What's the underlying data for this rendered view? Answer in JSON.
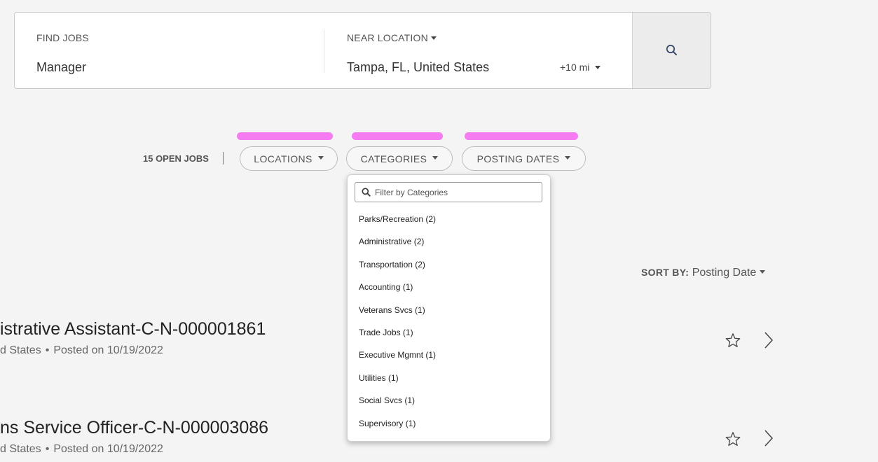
{
  "search": {
    "find_jobs_label": "FIND JOBS",
    "find_jobs_value": "Manager",
    "near_location_label": "NEAR LOCATION",
    "location_value": "Tampa, FL, United States",
    "radius_value": "+10 mi",
    "search_icon": "magnifier-icon"
  },
  "filters": {
    "jobs_count": "15 OPEN JOBS",
    "locations_label": "LOCATIONS",
    "categories_label": "CATEGORIES",
    "posting_dates_label": "POSTING DATES",
    "highlight_color": "#f47cf0"
  },
  "categories_dropdown": {
    "placeholder": "Filter by Categories",
    "options": [
      "Parks/Recreation (2)",
      "Administrative (2)",
      "Transportation (2)",
      "Accounting (1)",
      "Veterans Svcs (1)",
      "Trade Jobs (1)",
      "Executive Mgmnt (1)",
      "Utilities (1)",
      "Social Svcs (1)",
      "Supervisory (1)"
    ]
  },
  "sort": {
    "label": "SORT BY:",
    "value": "Posting Date"
  },
  "jobs": [
    {
      "title": "istrative Assistant-C-N-000001861",
      "location": "d States",
      "posted": "Posted on 10/19/2022",
      "favorite_icon": "star-outline-icon",
      "open_icon": "chevron-right-icon"
    },
    {
      "title": "ns Service Officer-C-N-000003086",
      "location": "d States",
      "posted": "Posted on 10/19/2022",
      "favorite_icon": "star-outline-icon",
      "open_icon": "chevron-right-icon"
    }
  ]
}
